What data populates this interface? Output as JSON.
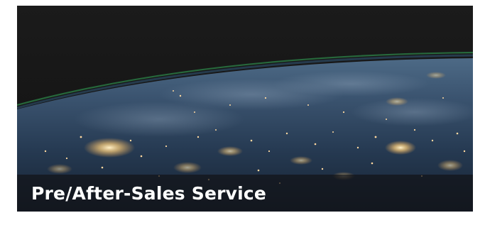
{
  "card": {
    "title": "Pre/After-Sales Service",
    "image_icon": "earth-night-image-icon",
    "title_color": "#ffffff",
    "caption_background": "#121418",
    "atmosphere_color": "#2e8a4c",
    "city_lights_color": "#ffd9a0"
  }
}
